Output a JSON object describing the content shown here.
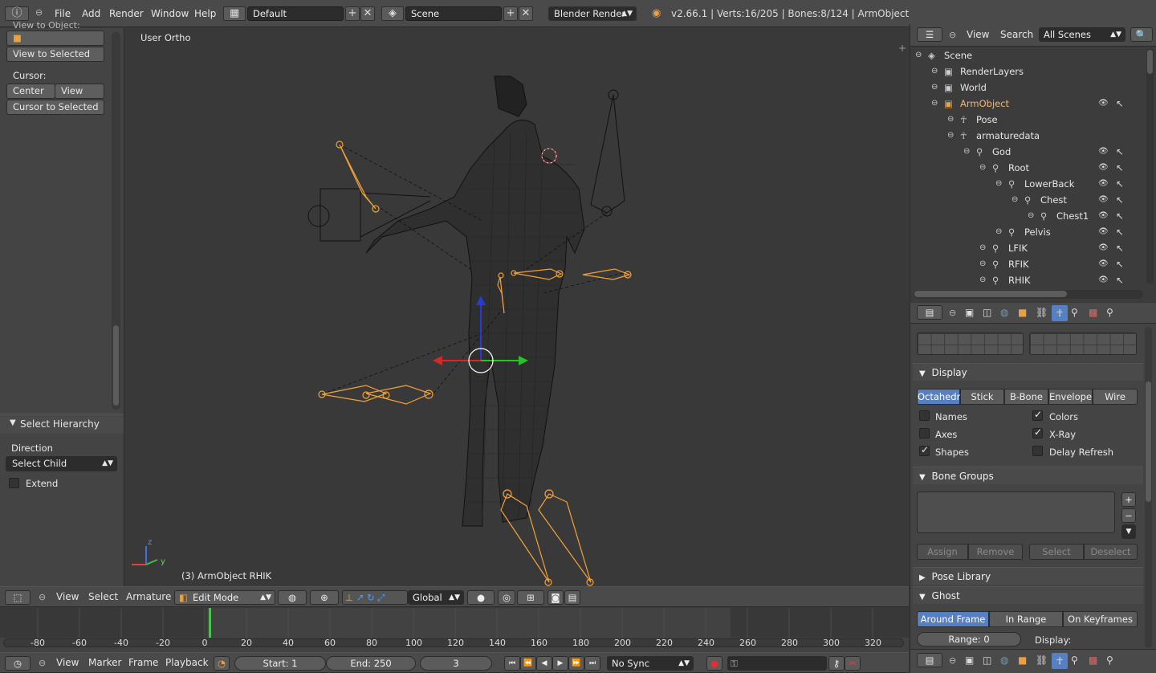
{
  "top_bar": {
    "menus": [
      "File",
      "Add",
      "Render",
      "Window",
      "Help"
    ],
    "layout": "Default",
    "scene": "Scene",
    "engine": "Blender Render",
    "status": "v2.66.1 | Verts:16/205 | Bones:8/124 | ArmObject"
  },
  "tool_shelf": {
    "section_cut": "View to Object:",
    "view_to_selected": "View to Selected",
    "cursor_label": "Cursor:",
    "center": "Center",
    "view": "View",
    "cursor_to_selected": "Cursor to Selected",
    "panel_title": "Select Hierarchy",
    "direction_label": "Direction",
    "direction_value": "Select Child",
    "extend_label": "Extend"
  },
  "viewport": {
    "view_name": "User Ortho",
    "object_info": "(3) ArmObject RHIK"
  },
  "view3d_header": {
    "menus": [
      "View",
      "Select",
      "Armature"
    ],
    "mode": "Edit Mode",
    "orientation": "Global"
  },
  "timeline": {
    "ticks": [
      "-80",
      "-60",
      "-40",
      "-20",
      "0",
      "20",
      "40",
      "60",
      "80",
      "100",
      "120",
      "140",
      "160",
      "180",
      "200",
      "220",
      "240",
      "260",
      "280",
      "300",
      "320"
    ],
    "current_frame_value": 3
  },
  "timeline_header": {
    "menus": [
      "View",
      "Marker",
      "Frame",
      "Playback"
    ],
    "start": "Start: 1",
    "end": "End: 250",
    "current": "3",
    "sync": "No Sync"
  },
  "outliner": {
    "menus": [
      "View",
      "Search"
    ],
    "filter": "All Scenes",
    "rows": [
      {
        "label": "Scene",
        "level": 0
      },
      {
        "label": "RenderLayers",
        "level": 1
      },
      {
        "label": "World",
        "level": 1
      },
      {
        "label": "ArmObject",
        "level": 1,
        "selected": true
      },
      {
        "label": "Pose",
        "level": 2
      },
      {
        "label": "armaturedata",
        "level": 2
      },
      {
        "label": "God",
        "level": 3
      },
      {
        "label": "Root",
        "level": 4
      },
      {
        "label": "LowerBack",
        "level": 5
      },
      {
        "label": "Chest",
        "level": 6
      },
      {
        "label": "Chest1",
        "level": 7
      },
      {
        "label": "Pelvis",
        "level": 5
      },
      {
        "label": "LFIK",
        "level": 4
      },
      {
        "label": "RFIK",
        "level": 4
      },
      {
        "label": "RHIK",
        "level": 4
      }
    ]
  },
  "properties": {
    "display_title": "Display",
    "display_types": [
      "Octahedral",
      "Stick",
      "B-Bone",
      "Envelope",
      "Wire"
    ],
    "active_type": "Octahedral",
    "checks": [
      {
        "label": "Names",
        "checked": false
      },
      {
        "label": "Colors",
        "checked": true
      },
      {
        "label": "Axes",
        "checked": false
      },
      {
        "label": "X-Ray",
        "checked": true
      },
      {
        "label": "Shapes",
        "checked": true
      },
      {
        "label": "Delay Refresh",
        "checked": false
      }
    ],
    "bone_groups_title": "Bone Groups",
    "bone_group_buttons": [
      "Assign",
      "Remove",
      "Select",
      "Deselect"
    ],
    "pose_library_title": "Pose Library",
    "ghost_title": "Ghost",
    "ghost_types": [
      "Around Frame",
      "In Range",
      "On Keyframes"
    ],
    "range": "Range: 0",
    "display_label": "Display:"
  },
  "colors": {
    "selection_orange": "#f3a23a",
    "active_blue": "#5680c2",
    "background": "#393939"
  }
}
